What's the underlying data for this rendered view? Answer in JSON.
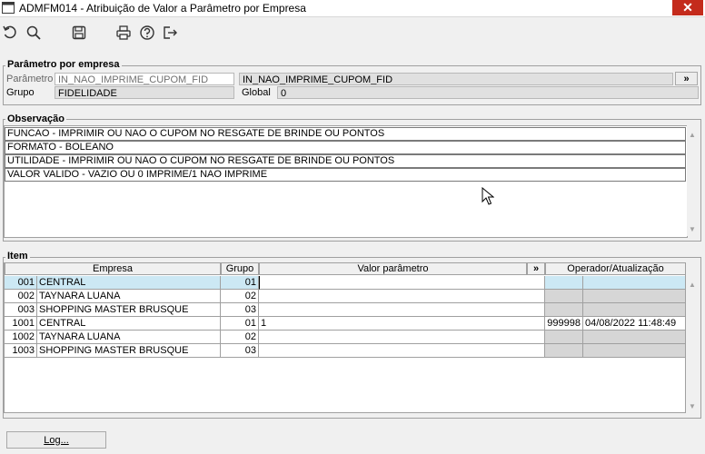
{
  "window": {
    "title": "ADMFM014 - Atribuição de Valor a Parâmetro por Empresa",
    "close": "✕"
  },
  "toolbar": {
    "icons": [
      "undo-icon",
      "search-icon",
      "save-icon",
      "print-icon",
      "help-icon",
      "exit-icon"
    ]
  },
  "param": {
    "title": "Parâmetro por empresa",
    "param_label": "Parâmetro",
    "param_code": "IN_NAO_IMPRIME_CUPOM_FID",
    "param_name": "IN_NAO_IMPRIME_CUPOM_FID",
    "group_label": "Grupo",
    "group_value": "FIDELIDADE",
    "global_label": "Global",
    "global_value": "0",
    "expand": "»"
  },
  "obs": {
    "title": "Observação",
    "lines": [
      "FUNCAO - IMPRIMIR OU NAO O CUPOM NO RESGATE DE BRINDE OU PONTOS",
      "FORMATO - BOLEANO",
      "UTILIDADE  - IMPRIMIR OU NAO O CUPOM NO RESGATE DE BRINDE OU PONTOS",
      "VALOR VALIDO - VAZIO OU 0 IMPRIME/1 NAO IMPRIME"
    ]
  },
  "items": {
    "title": "Item",
    "headers": {
      "empresa": "Empresa",
      "grupo": "Grupo",
      "valor": "Valor parâmetro",
      "expand": "»",
      "operador": "Operador/Atualização"
    },
    "rows": [
      {
        "code": "001",
        "name": "CENTRAL",
        "grupo": "01",
        "valor": "",
        "operador": "",
        "data": ""
      },
      {
        "code": "002",
        "name": "TAYNARA LUANA",
        "grupo": "02",
        "valor": "",
        "operador": "",
        "data": ""
      },
      {
        "code": "003",
        "name": "SHOPPING MASTER BRUSQUE",
        "grupo": "03",
        "valor": "",
        "operador": "",
        "data": ""
      },
      {
        "code": "1001",
        "name": "CENTRAL",
        "grupo": "01",
        "valor": "1",
        "operador": "999998",
        "data": "04/08/2022 11:48:49"
      },
      {
        "code": "1002",
        "name": "TAYNARA LUANA",
        "grupo": "02",
        "valor": "",
        "operador": "",
        "data": ""
      },
      {
        "code": "1003",
        "name": "SHOPPING MASTER BRUSQUE",
        "grupo": "03",
        "valor": "",
        "operador": "",
        "data": ""
      }
    ]
  },
  "footer": {
    "log_button": "Log..."
  }
}
